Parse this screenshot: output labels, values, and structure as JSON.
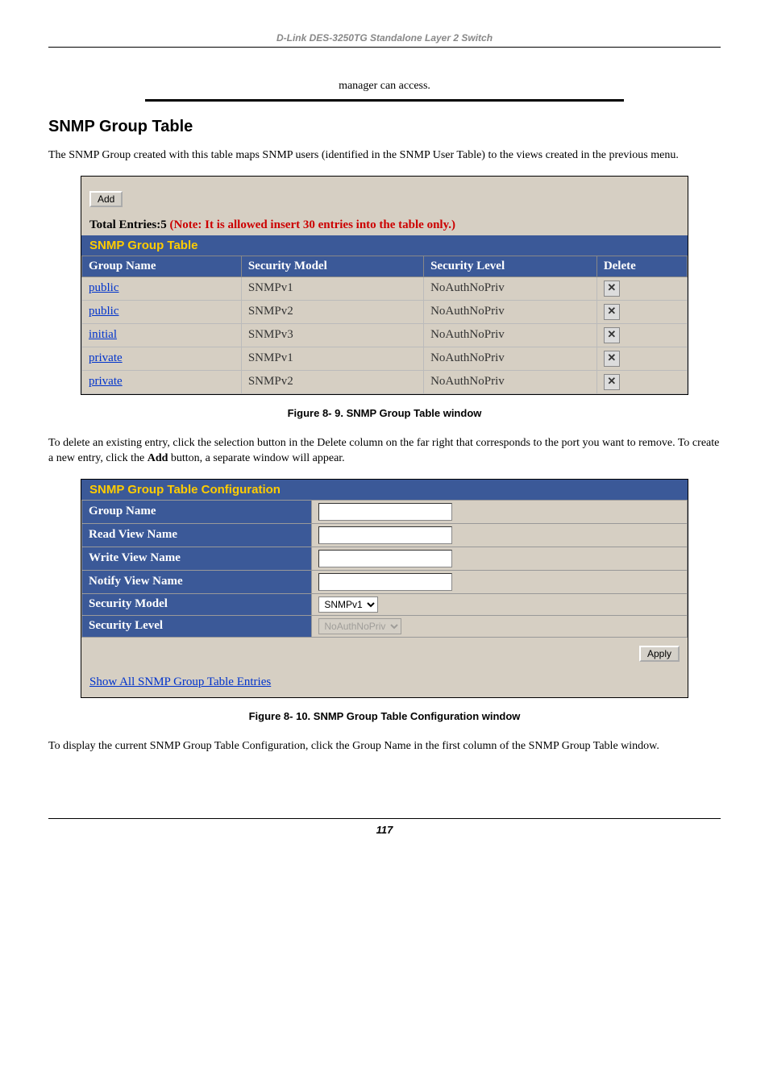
{
  "header": "D-Link DES-3250TG Standalone Layer 2 Switch",
  "manager_text": "manager can access.",
  "section_title": "SNMP Group Table",
  "intro_text_1": "The SNMP Group created with this table maps SNMP users (identified in the SNMP User Table) to the views created in the previous menu.",
  "add_button": "Add",
  "total_entries_prefix": "Total Entries:5 ",
  "total_entries_note": "(Note: It is allowed insert 30 entries into the table only.)",
  "table1_title": "SNMP Group Table",
  "table1_headers": {
    "col1": "Group Name",
    "col2": "Security Model",
    "col3": "Security Level",
    "col4": "Delete"
  },
  "table1_rows": [
    {
      "name": "public",
      "model": "SNMPv1",
      "level": "NoAuthNoPriv"
    },
    {
      "name": "public",
      "model": "SNMPv2",
      "level": "NoAuthNoPriv"
    },
    {
      "name": "initial",
      "model": "SNMPv3",
      "level": "NoAuthNoPriv"
    },
    {
      "name": "private",
      "model": "SNMPv1",
      "level": "NoAuthNoPriv"
    },
    {
      "name": "private",
      "model": "SNMPv2",
      "level": "NoAuthNoPriv"
    }
  ],
  "figure1_caption": "Figure 8- 9.  SNMP Group Table window",
  "para2_before": "To delete an existing entry, click the selection button in the Delete column on the far right that corresponds to the port you want to remove. To create a new entry, click the ",
  "para2_bold": "Add",
  "para2_after": " button, a separate window will appear.",
  "table2_title": "SNMP Group Table Configuration",
  "config_rows": {
    "group_name": "Group Name",
    "read_view": "Read View Name",
    "write_view": "Write View Name",
    "notify_view": "Notify View Name",
    "sec_model": "Security Model",
    "sec_level": "Security Level"
  },
  "sec_model_value": "SNMPv1",
  "sec_level_value": "NoAuthNoPriv",
  "apply_button": "Apply",
  "show_all_link": "Show All SNMP Group Table Entries",
  "figure2_caption": "Figure 8- 10.  SNMP Group Table Configuration window",
  "para3": "To display the current SNMP Group Table Configuration, click the Group Name in the first column of the SNMP Group Table window.",
  "page_number": "117"
}
